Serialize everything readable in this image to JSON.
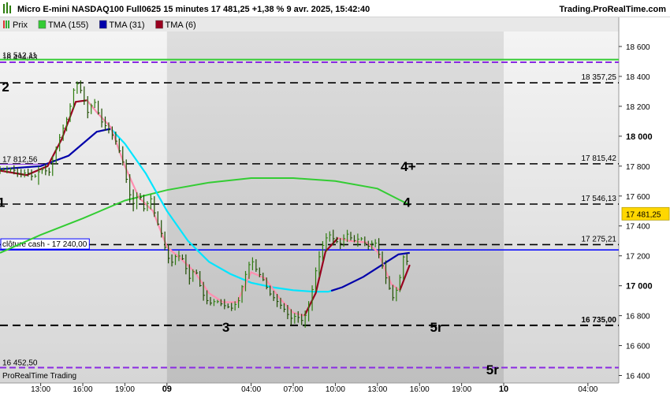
{
  "header": {
    "title": "Micro E-mini NASDAQ100 Full0625 15 minutes 17 481,25 +1,38 % 9 avr. 2025, 15:42:40",
    "site": "Trading.ProRealTime.com"
  },
  "footer": {
    "brand": "ProRealTime Trading"
  },
  "colors": {
    "price_up": "#2e7d0f",
    "price_down": "#1e4d00",
    "tma155": "#33cc33",
    "tma31_before": "#00e5ff",
    "tma31_after": "#0000aa",
    "tma6_up": "#ff8fb0",
    "tma6_down": "#99001f",
    "dashed": "#000000",
    "purple": "#8a2be2",
    "cash_line": "#0000ff",
    "green_level": "#33cc33",
    "price_tag": "#ffd700"
  },
  "chart_data": {
    "type": "line",
    "title": "Micro E-mini NASDAQ100 Full0625 15 minutes",
    "legend": [
      {
        "label": "Prix",
        "icon": "bar-swatch-icon"
      },
      {
        "label": "TMA (155)",
        "color": "#33cc33"
      },
      {
        "label": "TMA (31)",
        "color": "#0000aa"
      },
      {
        "label": "TMA (6)",
        "color": "#99001f"
      }
    ],
    "ylim": [
      16350,
      18700
    ],
    "y_ticks": [
      {
        "value": 18600,
        "label": "18 600",
        "bold": false
      },
      {
        "value": 18400,
        "label": "18 400",
        "bold": false
      },
      {
        "value": 18200,
        "label": "18 200",
        "bold": false
      },
      {
        "value": 18000,
        "label": "18 000",
        "bold": true
      },
      {
        "value": 17800,
        "label": "17 800",
        "bold": false
      },
      {
        "value": 17600,
        "label": "17 600",
        "bold": false
      },
      {
        "value": 17400,
        "label": "17 400",
        "bold": false
      },
      {
        "value": 17200,
        "label": "17 200",
        "bold": false
      },
      {
        "value": 17000,
        "label": "17 000",
        "bold": true
      },
      {
        "value": 16800,
        "label": "16 800",
        "bold": false
      },
      {
        "value": 16600,
        "label": "16 600",
        "bold": false
      },
      {
        "value": 16400,
        "label": "16 400",
        "bold": false
      }
    ],
    "x_ticks": [
      {
        "label": "13:00",
        "bold": false,
        "hour": 13
      },
      {
        "label": "16:00",
        "bold": false,
        "hour": 16
      },
      {
        "label": "19:00",
        "bold": false,
        "hour": 19
      },
      {
        "label": "09",
        "bold": true,
        "hour": 22
      },
      {
        "label": "04:00",
        "bold": false,
        "hour": 28
      },
      {
        "label": "07:00",
        "bold": false,
        "hour": 31
      },
      {
        "label": "10:00",
        "bold": false,
        "hour": 34
      },
      {
        "label": "13:00",
        "bold": false,
        "hour": 37
      },
      {
        "label": "16:00",
        "bold": false,
        "hour": 40
      },
      {
        "label": "19:00",
        "bold": false,
        "hour": 43
      },
      {
        "label": "10",
        "bold": true,
        "hour": 46
      },
      {
        "label": "04:00",
        "bold": false,
        "hour": 52
      }
    ],
    "shaded_session_hours": [
      22,
      46
    ],
    "levels": [
      {
        "value": 18357.25,
        "label": "18 357,25",
        "style": "dashed"
      },
      {
        "value": 17815.42,
        "label": "17 815,42",
        "style": "dashed"
      },
      {
        "value": 17546.13,
        "label": "17 546,13",
        "style": "dashed"
      },
      {
        "value": 17275.21,
        "label": "17 275,21",
        "style": "dashed"
      },
      {
        "value": 16735.0,
        "label": "16 735,00",
        "style": "dashed-bold"
      }
    ],
    "purple_levels": [
      {
        "value": 18494.63,
        "label": "18 494,63"
      },
      {
        "value": 16452.5,
        "label": "16 452,50"
      }
    ],
    "green_level": {
      "value": 18512.11,
      "label": "18 512,11"
    },
    "left_level": {
      "value": 17812.56,
      "label": "17 812,56"
    },
    "cash_close": {
      "value": 17240.0,
      "label": "clôture cash -  17 240,00"
    },
    "last_price": {
      "value": 17481.25,
      "label": "17 481,25"
    },
    "wave_labels": [
      {
        "text": "1",
        "hour": 10.2,
        "value": 17560
      },
      {
        "text": "2",
        "hour": 10.5,
        "value": 18330
      },
      {
        "text": "3",
        "hour": 26.2,
        "value": 16725
      },
      {
        "text": "4",
        "hour": 39.1,
        "value": 17560
      },
      {
        "text": "4+",
        "hour": 39.2,
        "value": 17800
      },
      {
        "text": "5r",
        "hour": 41.2,
        "value": 16725
      },
      {
        "text": "5r",
        "hour": 45.2,
        "value": 16440,
        "purple": true
      }
    ],
    "x_range_hours": [
      10.1,
      54.2
    ],
    "last_bar_hour": 39.3,
    "price_path": [
      [
        10.1,
        17775
      ],
      [
        11.0,
        17780
      ],
      [
        11.5,
        17740
      ],
      [
        12.0,
        17760
      ],
      [
        12.5,
        17720
      ],
      [
        13.0,
        17780
      ],
      [
        13.6,
        17760
      ],
      [
        14.3,
        17980
      ],
      [
        15.0,
        18150
      ],
      [
        15.3,
        18300
      ],
      [
        15.6,
        18350
      ],
      [
        16.0,
        18280
      ],
      [
        16.3,
        18150
      ],
      [
        16.8,
        18240
      ],
      [
        17.3,
        18100
      ],
      [
        17.8,
        18050
      ],
      [
        18.3,
        17980
      ],
      [
        18.8,
        17850
      ],
      [
        19.3,
        17620
      ],
      [
        19.6,
        17550
      ],
      [
        20.0,
        17620
      ],
      [
        20.4,
        17500
      ],
      [
        20.8,
        17600
      ],
      [
        21.2,
        17450
      ],
      [
        21.6,
        17350
      ],
      [
        22.0,
        17200
      ],
      [
        22.3,
        17150
      ],
      [
        22.7,
        17210
      ],
      [
        23.1,
        17180
      ],
      [
        23.6,
        17050
      ],
      [
        24.0,
        17120
      ],
      [
        24.5,
        16950
      ],
      [
        25.0,
        16880
      ],
      [
        25.5,
        16900
      ],
      [
        26.0,
        16870
      ],
      [
        26.6,
        16850
      ],
      [
        27.1,
        16900
      ],
      [
        27.5,
        17050
      ],
      [
        28.0,
        17180
      ],
      [
        28.4,
        17100
      ],
      [
        28.8,
        17050
      ],
      [
        29.3,
        16950
      ],
      [
        29.8,
        16900
      ],
      [
        30.3,
        16850
      ],
      [
        30.8,
        16780
      ],
      [
        31.2,
        16800
      ],
      [
        31.7,
        16760
      ],
      [
        32.2,
        16900
      ],
      [
        32.6,
        17100
      ],
      [
        33.0,
        17250
      ],
      [
        33.5,
        17350
      ],
      [
        34.0,
        17300
      ],
      [
        34.4,
        17280
      ],
      [
        34.8,
        17350
      ],
      [
        35.3,
        17300
      ],
      [
        35.8,
        17320
      ],
      [
        36.3,
        17260
      ],
      [
        36.8,
        17300
      ],
      [
        37.3,
        17150
      ],
      [
        37.7,
        17020
      ],
      [
        38.1,
        16920
      ],
      [
        38.5,
        17000
      ],
      [
        38.9,
        17220
      ],
      [
        39.15,
        17150
      ],
      [
        39.3,
        17481
      ]
    ],
    "tma155_path": [
      [
        10.1,
        17220
      ],
      [
        13.0,
        17340
      ],
      [
        16.0,
        17450
      ],
      [
        19.0,
        17570
      ],
      [
        22.0,
        17640
      ],
      [
        25.0,
        17690
      ],
      [
        28.0,
        17720
      ],
      [
        31.0,
        17720
      ],
      [
        34.0,
        17700
      ],
      [
        37.0,
        17650
      ],
      [
        39.3,
        17540
      ]
    ],
    "tma31_path": [
      [
        10.1,
        17780
      ],
      [
        13.0,
        17800
      ],
      [
        15.0,
        17870
      ],
      [
        17.0,
        18030
      ],
      [
        18.0,
        18050
      ],
      [
        19.0,
        17950
      ],
      [
        20.5,
        17750
      ],
      [
        22.0,
        17500
      ],
      [
        23.5,
        17300
      ],
      [
        25.0,
        17160
      ],
      [
        26.5,
        17080
      ],
      [
        28.0,
        17020
      ],
      [
        29.5,
        16990
      ],
      [
        31.0,
        16970
      ],
      [
        32.5,
        16960
      ],
      [
        33.5,
        16960
      ],
      [
        34.5,
        16990
      ],
      [
        36.0,
        17060
      ],
      [
        37.5,
        17150
      ],
      [
        38.5,
        17210
      ],
      [
        39.3,
        17220
      ]
    ],
    "tma31_color_switch_hour": 33.7,
    "tma6_path": [
      [
        10.1,
        17770
      ],
      [
        12.0,
        17740
      ],
      [
        13.5,
        17800
      ],
      [
        14.5,
        17980
      ],
      [
        15.5,
        18230
      ],
      [
        16.3,
        18240
      ],
      [
        17.0,
        18160
      ],
      [
        18.0,
        18060
      ],
      [
        19.0,
        17800
      ],
      [
        20.0,
        17590
      ],
      [
        21.0,
        17500
      ],
      [
        22.0,
        17260
      ],
      [
        23.0,
        17180
      ],
      [
        24.0,
        17090
      ],
      [
        25.0,
        16950
      ],
      [
        26.0,
        16890
      ],
      [
        27.0,
        16890
      ],
      [
        28.0,
        17090
      ],
      [
        29.0,
        17050
      ],
      [
        30.0,
        16920
      ],
      [
        31.0,
        16820
      ],
      [
        31.8,
        16800
      ],
      [
        32.6,
        16950
      ],
      [
        33.3,
        17230
      ],
      [
        34.2,
        17320
      ],
      [
        35.0,
        17300
      ],
      [
        36.2,
        17290
      ],
      [
        37.0,
        17230
      ],
      [
        38.0,
        17010
      ],
      [
        38.6,
        16970
      ],
      [
        39.3,
        17140
      ]
    ],
    "tma6_turn_points": [
      16.3,
      31.8,
      34.2,
      38.6
    ]
  }
}
